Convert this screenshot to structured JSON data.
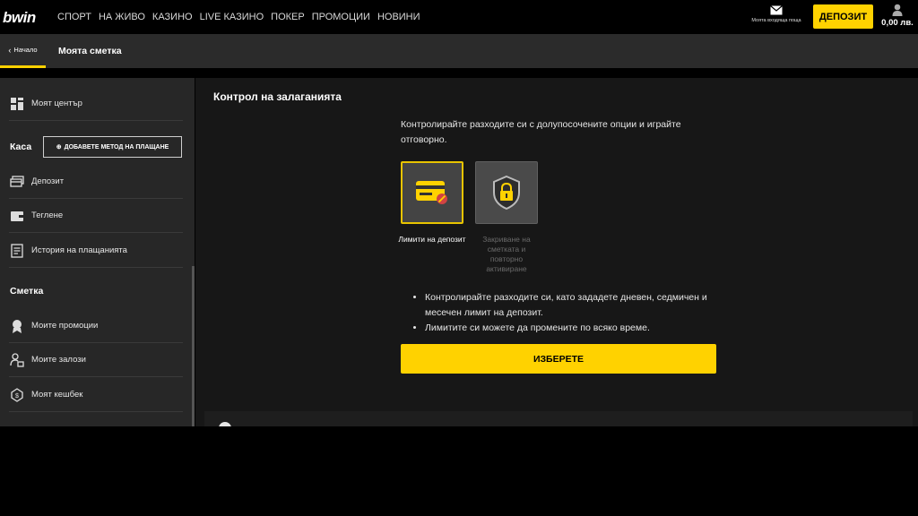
{
  "header": {
    "logo": "bwin",
    "nav": [
      "СПОРТ",
      "НА ЖИВО",
      "КАЗИНО",
      "LIVE КАЗИНО",
      "ПОКЕР",
      "ПРОМОЦИИ",
      "НОВИНИ"
    ],
    "messages_label": "Моята входяща поща",
    "deposit_label": "ДЕПОЗИТ",
    "balance": "0,00 лв."
  },
  "subheader": {
    "back_label": "Начало",
    "title": "Моята сметка"
  },
  "sidebar": {
    "my_center": "Моят център",
    "cashier_section": "Каса",
    "add_method": "ДОБАВЕТЕ МЕТОД НА ПЛАЩАНЕ",
    "deposit": "Депозит",
    "withdraw": "Теглене",
    "payment_history": "История на плащанията",
    "account_section": "Сметка",
    "my_promotions": "Моите промоции",
    "my_bets": "Моите залози",
    "my_cashback": "Моят кешбек"
  },
  "main": {
    "title": "Контрол на залаганията",
    "intro": "Контролирайте разходите си с долупосочените опции и играйте отговорно.",
    "option1_label": "Лимити на депозит",
    "option2_label": "Закриване на сметката и повторно активиране",
    "bullets": [
      "Контролирайте разходите си, като зададете дневен, седмичен и месечен лимит на депозит.",
      "Лимитите си можете да промените по всяко време."
    ],
    "select_label": "ИЗБЕРЕТЕ"
  },
  "colors": {
    "accent": "#ffd200",
    "header_bg": "#000000",
    "subheader_bg": "#2b2b2b",
    "sidebar_bg": "#272727",
    "main_bg": "#171717",
    "disabled_text": "#6a6a6a"
  },
  "icons": {
    "messages": "envelope-icon",
    "account": "user-icon",
    "back": "chevron-left-icon",
    "my_center": "dashboard-icon",
    "add_method": "plus-circle-icon",
    "deposit": "cards-icon",
    "withdraw": "wallet-icon",
    "payment_history": "receipt-icon",
    "my_promotions": "award-icon",
    "my_bets": "bet-user-icon",
    "my_cashback": "dollar-shield-icon",
    "option1": "credit-card-limit-icon",
    "option2": "shield-lock-icon"
  }
}
